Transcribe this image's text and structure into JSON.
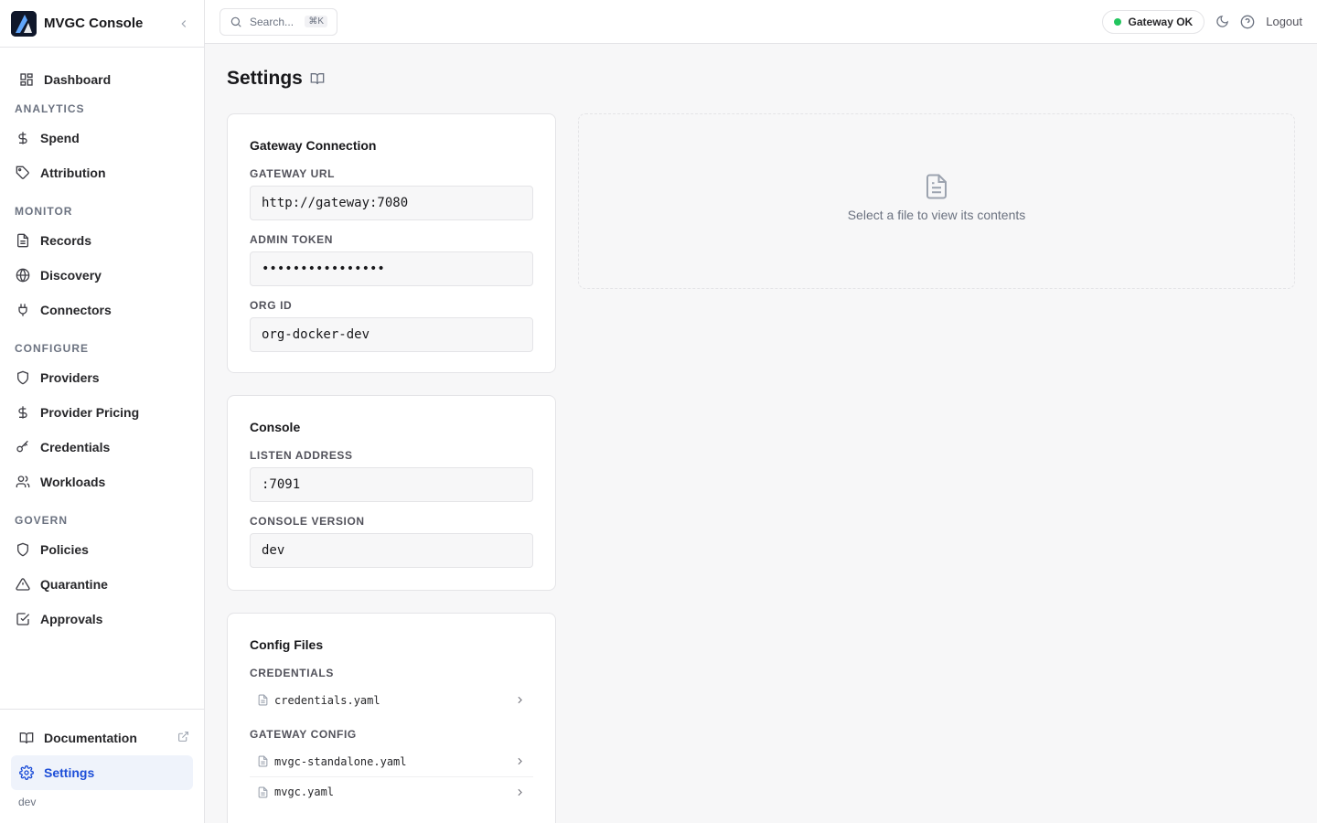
{
  "app": {
    "title": "MVGC Console"
  },
  "sidebar": {
    "dashboard": "Dashboard",
    "sections": {
      "analytics": "ANALYTICS",
      "monitor": "MONITOR",
      "configure": "CONFIGURE",
      "govern": "GOVERN"
    },
    "items": {
      "spend": "Spend",
      "attribution": "Attribution",
      "records": "Records",
      "discovery": "Discovery",
      "connectors": "Connectors",
      "providers": "Providers",
      "provider_pricing": "Provider Pricing",
      "credentials": "Credentials",
      "workloads": "Workloads",
      "policies": "Policies",
      "quarantine": "Quarantine",
      "approvals": "Approvals"
    },
    "bottom": {
      "documentation": "Documentation",
      "settings": "Settings",
      "env": "dev"
    }
  },
  "topbar": {
    "search_placeholder": "Search...",
    "search_shortcut": "⌘K",
    "status": "Gateway OK",
    "status_color": "#22c55e",
    "logout": "Logout"
  },
  "page": {
    "title": "Settings"
  },
  "gateway": {
    "title": "Gateway Connection",
    "url_label": "GATEWAY URL",
    "url_value": "http://gateway:7080",
    "token_label": "ADMIN TOKEN",
    "token_value": "••••••••••••••••",
    "org_label": "ORG ID",
    "org_value": "org-docker-dev"
  },
  "console": {
    "title": "Console",
    "listen_label": "LISTEN ADDRESS",
    "listen_value": ":7091",
    "version_label": "CONSOLE VERSION",
    "version_value": "dev"
  },
  "config_files": {
    "title": "Config Files",
    "groups": [
      {
        "label": "CREDENTIALS",
        "files": [
          "credentials.yaml"
        ]
      },
      {
        "label": "GATEWAY CONFIG",
        "files": [
          "mvgc-standalone.yaml",
          "mvgc.yaml"
        ]
      }
    ]
  },
  "viewer": {
    "empty_text": "Select a file to view its contents"
  },
  "colors": {
    "accent": "#1d4ed8",
    "active_bg": "#eff3fb"
  }
}
